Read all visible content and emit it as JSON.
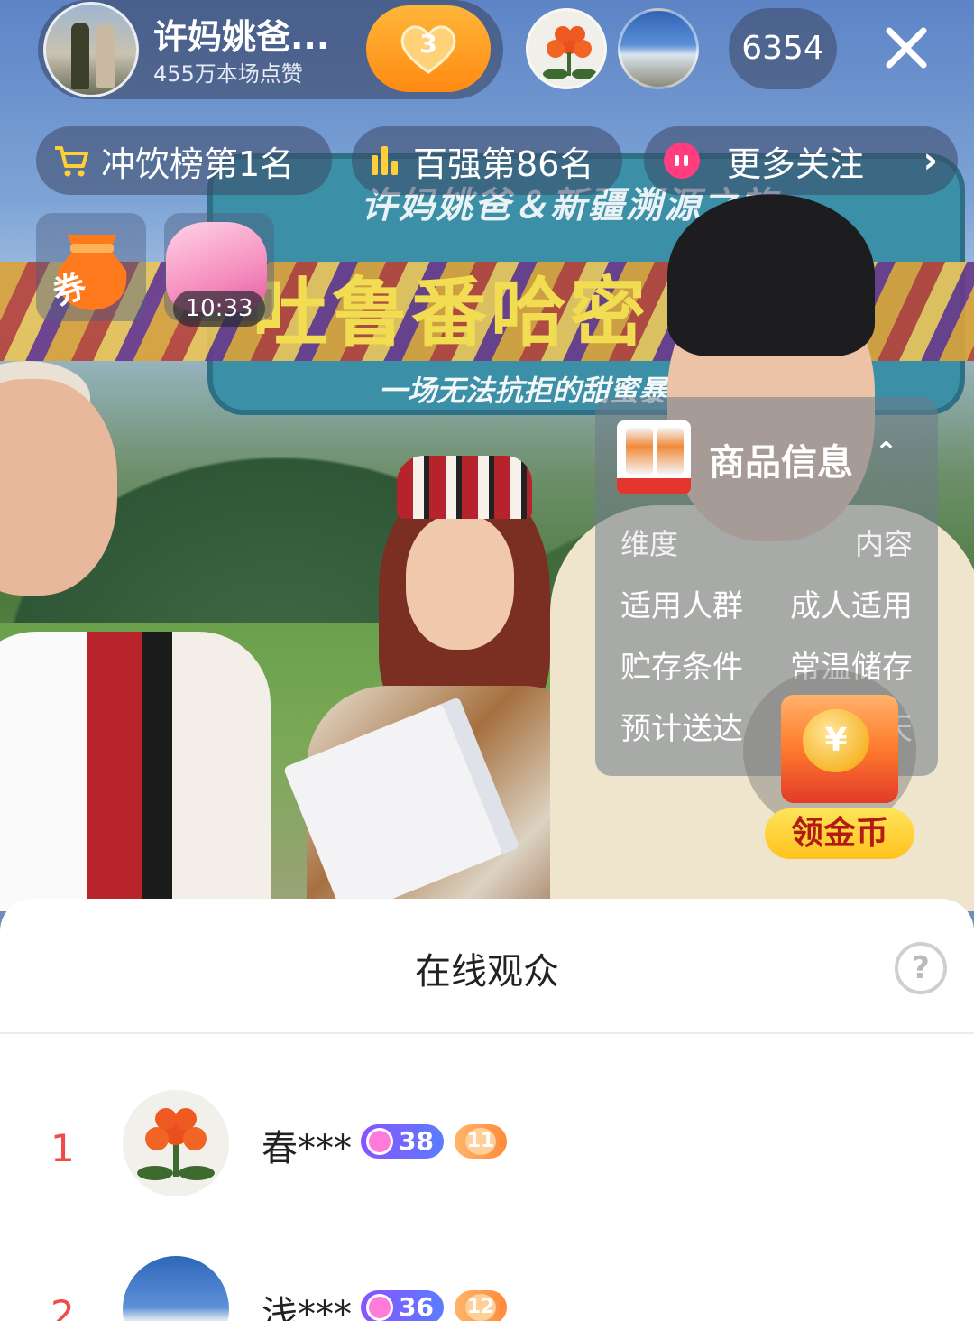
{
  "header": {
    "anchor_name": "许妈姚爸...",
    "likes_text": "455万本场点赞",
    "fan_club_level": "3",
    "viewer_count": "6354"
  },
  "chips": {
    "drink_rank": "冲饮榜第1名",
    "top100_rank": "百强第86名",
    "more_follow": "更多关注"
  },
  "activity": {
    "coupon_label": "券",
    "gift_timer": "10:33"
  },
  "stream_banner": {
    "line1": "许妈姚爸＆新疆溯源之旅",
    "line2": "吐鲁番哈密",
    "line3": "一场无法抗拒的甜蜜暴"
  },
  "product_card": {
    "title": "商品信息",
    "header_key": "维度",
    "header_value": "内容",
    "rows": [
      {
        "key": "适用人群",
        "value": "成人适用"
      },
      {
        "key": "贮存条件",
        "value": "常温储存"
      },
      {
        "key": "预计送达",
        "value": "天"
      }
    ]
  },
  "coin_widget": {
    "coin_symbol": "¥",
    "button_label": "领金币"
  },
  "audience": {
    "title": "在线观众",
    "help_symbol": "?",
    "viewers": [
      {
        "rank": "1",
        "name": "春***",
        "level": "38",
        "fan_level": "11"
      },
      {
        "rank": "2",
        "name": "浅***",
        "level": "36",
        "fan_level": "12"
      }
    ]
  },
  "colors": {
    "accent_orange": "#ff8a12",
    "rank_red": "#f04a4a",
    "level_purple": "#8a52ff",
    "coin_yellow": "#ffc21e"
  }
}
